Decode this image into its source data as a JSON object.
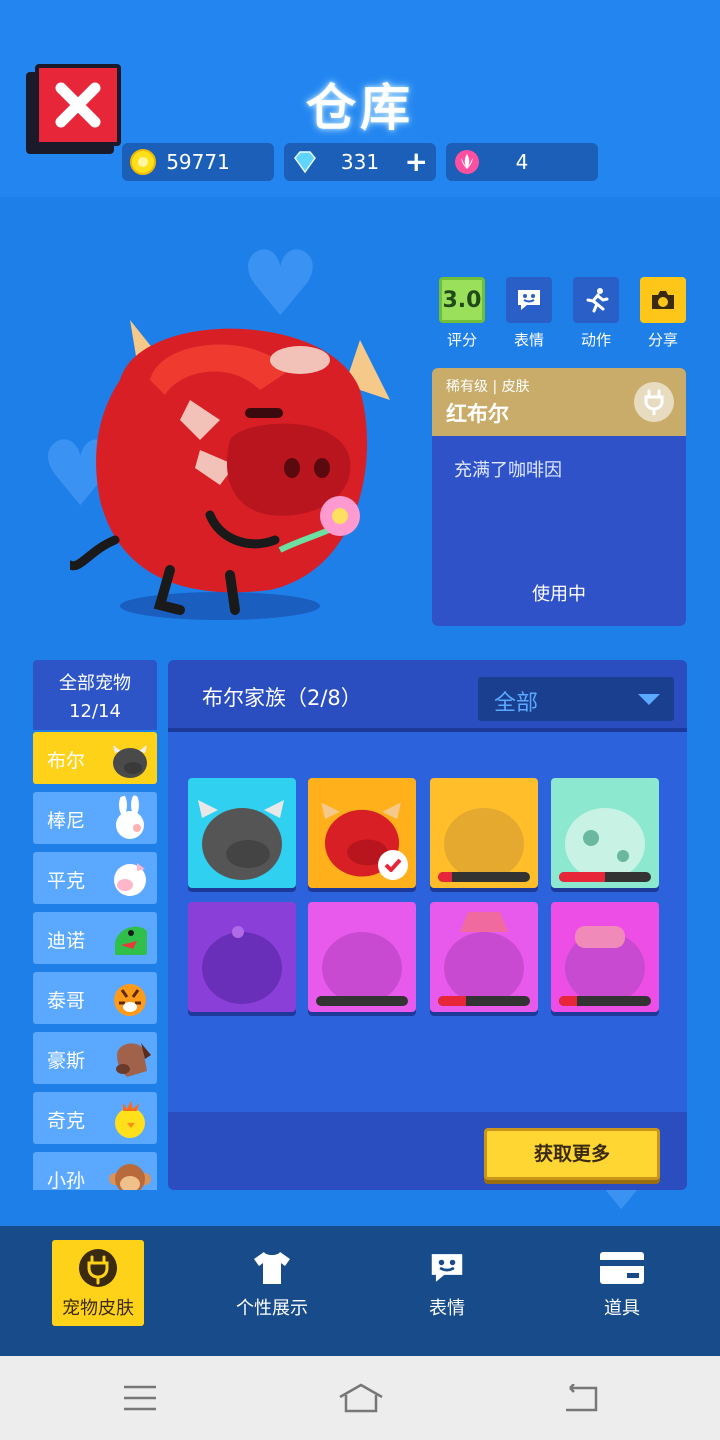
{
  "header": {
    "title": "仓库",
    "close_icon": "close-icon",
    "currencies": [
      {
        "icon": "gold-coin-icon",
        "value": "59771"
      },
      {
        "icon": "diamond-icon",
        "value": "331"
      },
      {
        "icon": "flower-token-icon",
        "value": "4"
      }
    ],
    "add_symbol": "+"
  },
  "actions": [
    {
      "id": "rating",
      "value": "3.0",
      "label": "评分"
    },
    {
      "id": "emote",
      "icon": "chat-bubble-icon",
      "label": "表情"
    },
    {
      "id": "motion",
      "icon": "running-icon",
      "label": "动作"
    },
    {
      "id": "share",
      "icon": "camera-icon",
      "label": "分享"
    }
  ],
  "skin_info": {
    "rarity": "稀有级",
    "type": "皮肤",
    "name": "红布尔",
    "description": "充满了咖啡因",
    "status": "使用中"
  },
  "pet_list": {
    "all_label": "全部宠物",
    "count": "12/14",
    "items": [
      {
        "name": "布尔",
        "selected": true
      },
      {
        "name": "棒尼"
      },
      {
        "name": "平克"
      },
      {
        "name": "迪诺"
      },
      {
        "name": "泰哥"
      },
      {
        "name": "豪斯"
      },
      {
        "name": "奇克"
      },
      {
        "name": "小孙"
      }
    ]
  },
  "panel": {
    "family_title": "布尔家族（2/8）",
    "filter_value": "全部",
    "more_button": "获取更多",
    "skins": [
      {
        "color": "#2fd0f0",
        "owned": true,
        "progress": null
      },
      {
        "color": "#ffb01a",
        "owned": true,
        "selected": true,
        "progress": null
      },
      {
        "color": "#ffbe2a",
        "progress": 0.15
      },
      {
        "color": "#8de8d0",
        "progress": 0.5
      },
      {
        "color": "#8a3fd8",
        "progress": null
      },
      {
        "color": "#e85aec",
        "progress": 0.0
      },
      {
        "color": "#e85aec",
        "progress": 0.3
      },
      {
        "color": "#ec4ee6",
        "progress": 0.2
      }
    ]
  },
  "bottom_nav": [
    {
      "label": "宠物皮肤",
      "icon": "plug-icon",
      "selected": true
    },
    {
      "label": "个性展示",
      "icon": "tshirt-icon"
    },
    {
      "label": "表情",
      "icon": "chat-bubble-icon"
    },
    {
      "label": "道具",
      "icon": "card-icon"
    }
  ],
  "system_nav": [
    "menu-icon",
    "home-icon",
    "back-icon"
  ]
}
